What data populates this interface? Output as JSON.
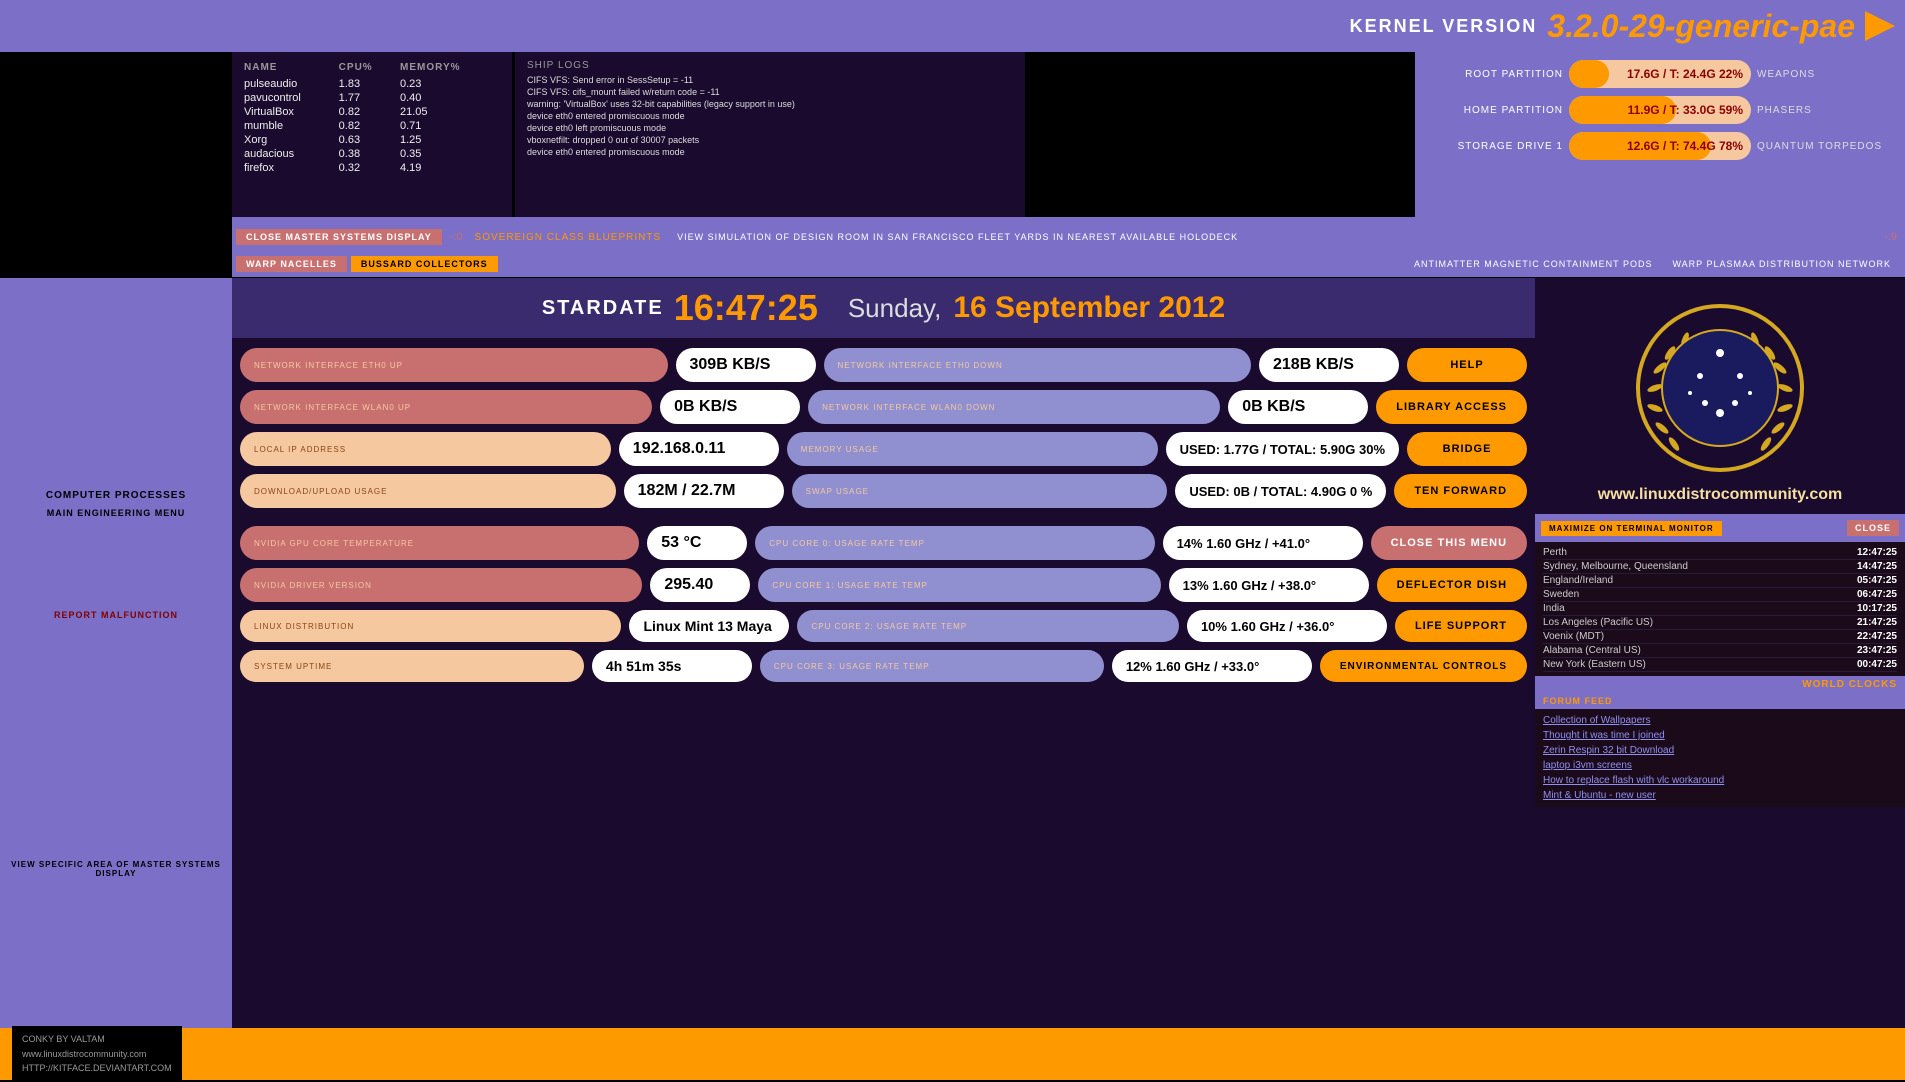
{
  "header": {
    "kernel_label": "KERNEL VERSION",
    "kernel_version": "3.2.0-29-generic-pae"
  },
  "processes": {
    "section_label": "COMPUTER PROCESSES",
    "menu_label": "MAIN ENGINEERING MENU",
    "columns": [
      "NAME",
      "CPU%",
      "MEMORY%"
    ],
    "rows": [
      {
        "name": "pulseaudio",
        "cpu": "1.83",
        "mem": "0.23"
      },
      {
        "name": "pavucontrol",
        "cpu": "1.77",
        "mem": "0.40"
      },
      {
        "name": "VirtualBox",
        "cpu": "0.82",
        "mem": "21.05"
      },
      {
        "name": "mumble",
        "cpu": "0.82",
        "mem": "0.71"
      },
      {
        "name": "Xorg",
        "cpu": "0.63",
        "mem": "1.25"
      },
      {
        "name": "audacious",
        "cpu": "0.38",
        "mem": "0.35"
      },
      {
        "name": "firefox",
        "cpu": "0.32",
        "mem": "4.19"
      }
    ]
  },
  "ship_logs": {
    "label": "SHIP LOGS",
    "entries": [
      "CIFS VFS: Send error in SessSetup = -11",
      "CIFS VFS: cifs_mount failed w/return code = -11",
      "warning: 'VirtualBox' uses 32-bit capabilities (legacy support in use)",
      "device eth0 entered promiscuous mode",
      "device eth0 left promiscuous mode",
      "vboxnetfilt: dropped 0 out of 30007 packets",
      "device eth0 entered promiscuous mode"
    ]
  },
  "partitions": {
    "root": {
      "label": "ROOT PARTITION",
      "value": "17.6G / T: 24.4G 22%",
      "pct": 22,
      "side": "WEAPONS"
    },
    "home": {
      "label": "HOME PARTITION",
      "value": "11.9G / T: 33.0G 59%",
      "pct": 59,
      "side": "PHASERS"
    },
    "storage": {
      "label": "STORAGE DRIVE 1",
      "value": "12.6G / T: 74.4G 78%",
      "pct": 78,
      "side": "QUANTUM TORPEDOS"
    }
  },
  "menu_bar": {
    "close_master": "CLOSE MASTER SYSTEMS DISPLAY",
    "divider": "-:0",
    "blueprints": "SOVEREIGN CLASS BLUEPRINTS",
    "view_simulation": "VIEW SIMULATION OF DESIGN ROOM IN SAN FRANCISCO FLEET YARDS IN NEAREST AVAILABLE HOLODECK",
    "divider2": "-:9"
  },
  "nav_bar": {
    "warp": "WARP NACELLES",
    "bussard": "BUSSARD COLLECTORS",
    "antimatter": "ANTIMATTER MAGNETIC CONTAINMENT PODS",
    "warp_plasma": "WARP PLASMAA DISTRIBUTION NETWORK"
  },
  "stardate": {
    "label": "STARDATE",
    "time": "16:47:25",
    "day": "Sunday,",
    "date": "16 September 2012"
  },
  "network": {
    "eth0_up_label": "NETWORK INTERFACE ETH0 UP",
    "eth0_up_val": "309B KB/S",
    "eth0_down_label": "NETWORK INTERFACE ETH0 DOWN",
    "eth0_down_val": "218B KB/S",
    "wlan0_up_label": "NETWORK INTERFACE WLAN0 UP",
    "wlan0_up_val": "0B  KB/S",
    "wlan0_down_label": "NETWORK INTERFACE WLAN0 DOWN",
    "wlan0_down_val": "0B  KB/S",
    "local_ip_label": "LOCAL IP ADDRESS",
    "local_ip_val": "192.168.0.11",
    "memory_label": "MEMORY USAGE",
    "memory_val": "USED: 1.77G / TOTAL: 5.90G  30%",
    "download_label": "DOWNLOAD/UPLOAD USAGE",
    "download_val": "182M / 22.7M",
    "swap_label": "SWAP USAGE",
    "swap_val": "USED: 0B  / TOTAL: 4.90G   0 %"
  },
  "gpu": {
    "temp_label": "NVIDIA GPU CORE TEMPERATURE",
    "temp_val": "53 °C",
    "driver_label": "NVIDIA DRIVER VERSION",
    "driver_val": "295.40",
    "distro_label": "LINUX DISTRIBUTION",
    "distro_val": "Linux Mint 13 Maya",
    "uptime_label": "SYSTEM UPTIME",
    "uptime_val": "4h 51m 35s"
  },
  "cpu_cores": {
    "core0_label": "CPU CORE 0: USAGE RATE TEMP",
    "core0_val": "14%  1.60 GHz /  +41.0°",
    "core1_label": "CPU CORE 1: USAGE RATE TEMP",
    "core1_val": "13%  1.60 GHz /  +38.0°",
    "core2_label": "CPU CORE 2: USAGE RATE TEMP",
    "core2_val": "10%  1.60 GHz /  +36.0°",
    "core3_label": "CPU CORE 3: USAGE RATE TEMP",
    "core3_val": "12%  1.60 GHz /  +33.0°"
  },
  "right_buttons": {
    "help": "HELP",
    "library": "LIBRARY ACCESS",
    "bridge": "BRIDGE",
    "ten_forward": "TEN FORWARD",
    "close_menu": "CLOSE THIS MENU",
    "deflector": "DEFLECTOR DISH",
    "life_support": "LIFE SUPPORT",
    "environmental": "ENVIRONMENTAL CONTROLS"
  },
  "world_clocks": {
    "section_label": "WORLD CLOCKS",
    "maximize_btn": "MAXIMIZE ON TERMINAL MONITOR",
    "close_btn": "CLOSE",
    "clocks": [
      {
        "city": "Perth",
        "time": "12:47:25"
      },
      {
        "city": "Sydney, Melbourne, Queensland",
        "time": "14:47:25"
      },
      {
        "city": "England/Ireland",
        "time": "05:47:25"
      },
      {
        "city": "Sweden",
        "time": "06:47:25"
      },
      {
        "city": "India",
        "time": "10:17:25"
      },
      {
        "city": "Los Angeles (Pacific US)",
        "time": "21:47:25"
      },
      {
        "city": "Voenix (MDT)",
        "time": "22:47:25"
      },
      {
        "city": "Alabama (Central US)",
        "time": "23:47:25"
      },
      {
        "city": "New York (Eastern US)",
        "time": "00:47:25"
      }
    ]
  },
  "forum_feed": {
    "label": "FORUM FEED",
    "items": [
      "Collection of Wallpapers",
      "Thought it was time I joined",
      "Zerin Respin 32 bit Download",
      "laptop i3vm screens",
      "How to replace flash with vlc workaround",
      "Mint & Ubuntu - new user"
    ]
  },
  "site_url": "www.linuxdistrocommunity.com",
  "left_bottom": {
    "conky": "CONKY BY VALTAM",
    "url1": "www.linuxdistrocommunity.com",
    "url2": "HTTP://KITFACE.DEVIANTART.COM"
  }
}
